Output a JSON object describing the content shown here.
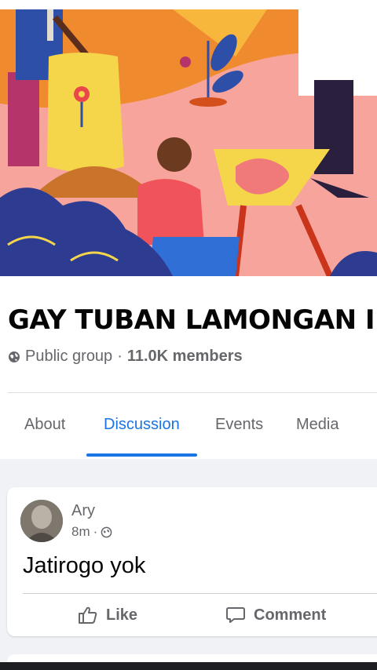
{
  "group": {
    "name": "GAY TUBAN LAMONGAN I",
    "privacy": "Public group",
    "separator": "·",
    "members": "11.0K members"
  },
  "icons": {
    "privacy": "globe-icon",
    "like": "thumbs-up-icon",
    "comment": "speech-bubble-icon",
    "post_audience": "globe-icon"
  },
  "tabs": [
    {
      "label": "About",
      "active": false
    },
    {
      "label": "Discussion",
      "active": true
    },
    {
      "label": "Events",
      "active": false
    },
    {
      "label": "Media",
      "active": false
    }
  ],
  "post": {
    "author": "Ary",
    "time": "8m",
    "separator": "·",
    "text": "Jatirogo yok",
    "actions": {
      "like": "Like",
      "comment": "Comment"
    }
  },
  "colors": {
    "accent": "#1b74e4",
    "secondary_text": "#65676b",
    "feed_background": "#f0f2f5"
  }
}
